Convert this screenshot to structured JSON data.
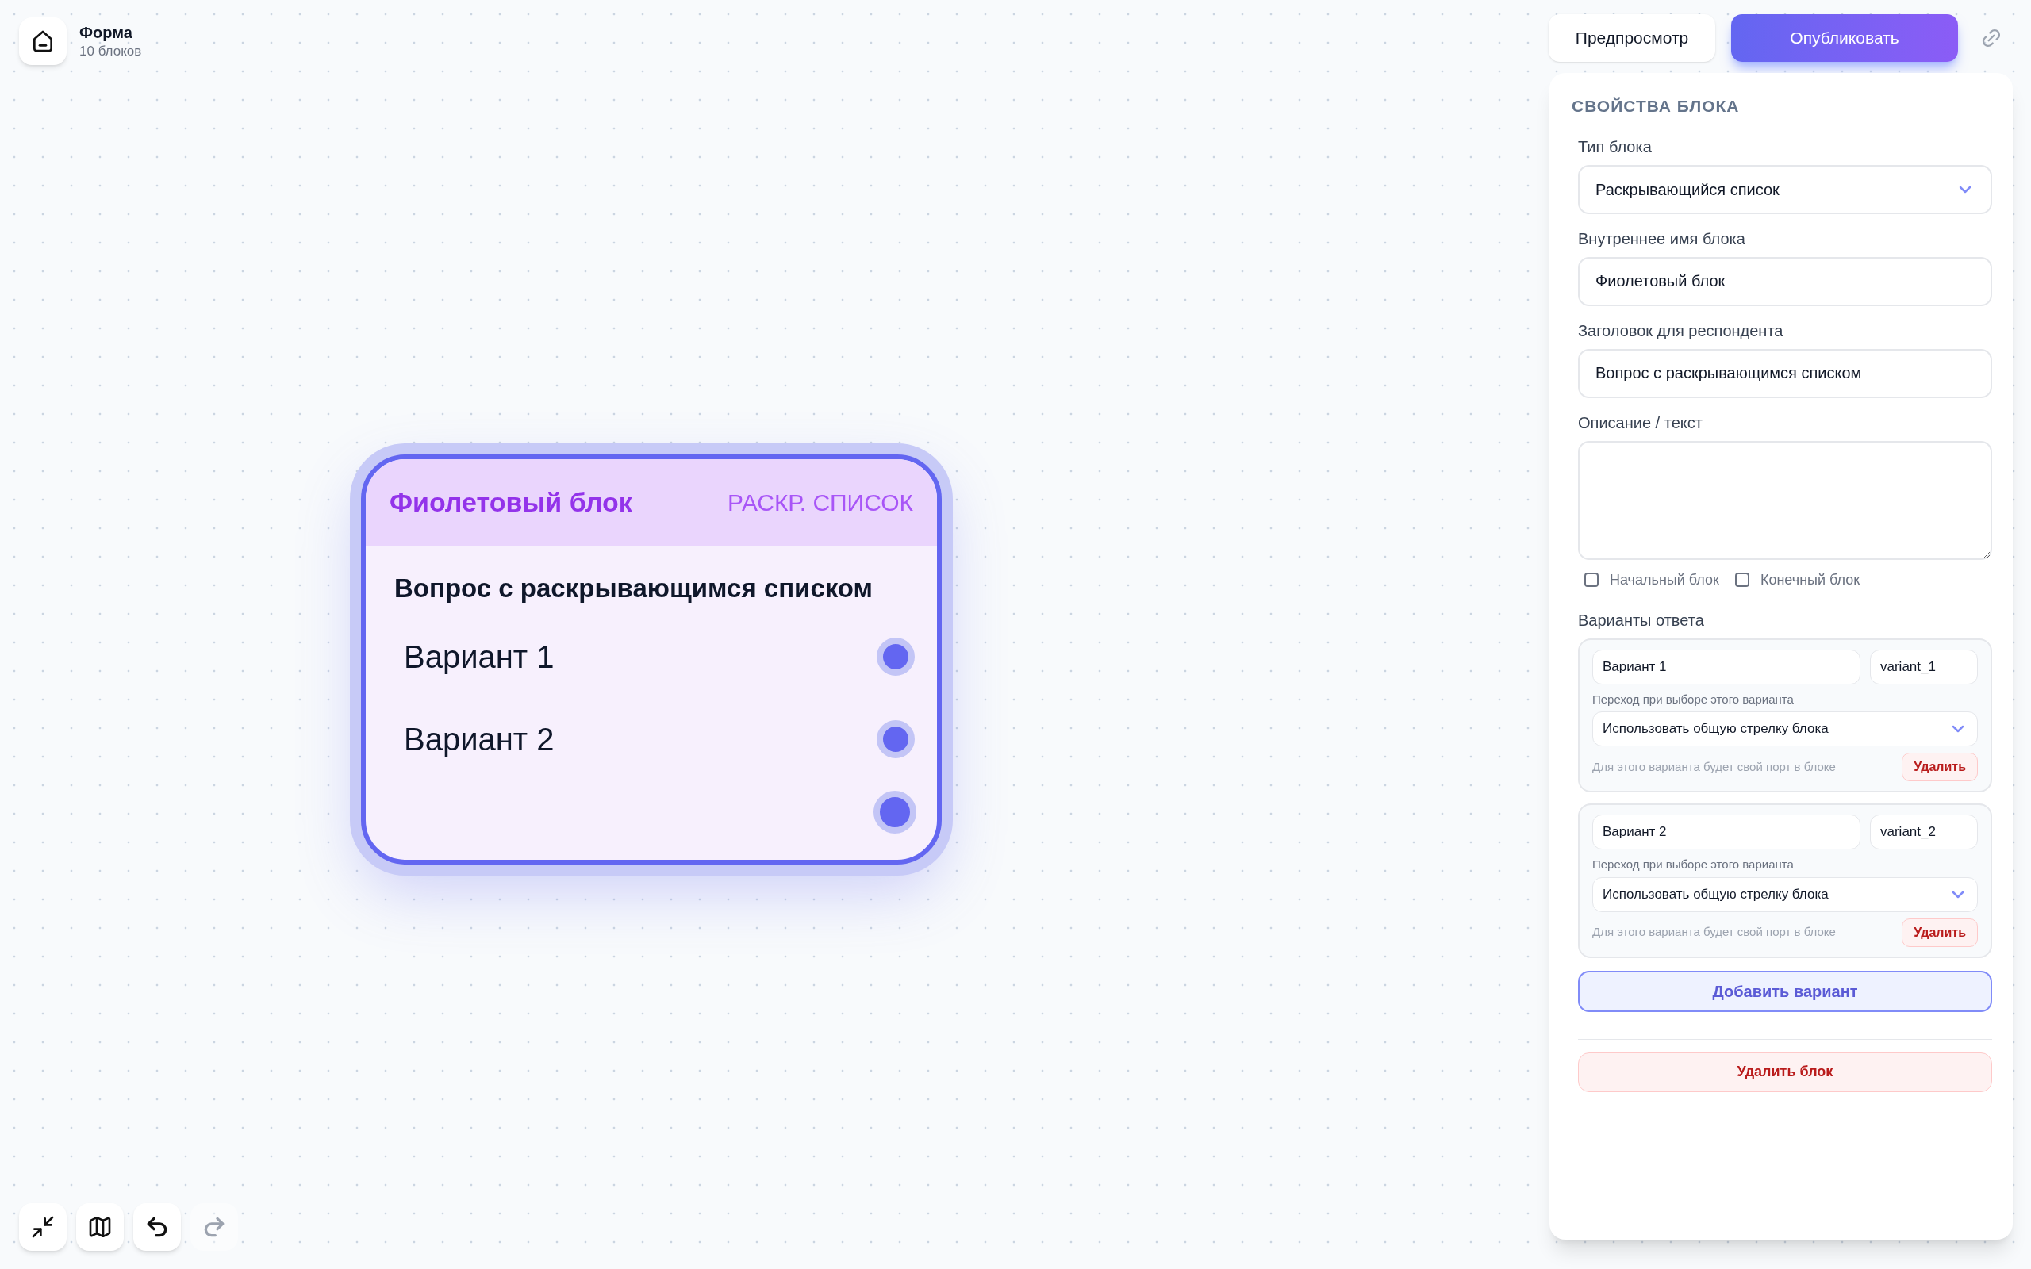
{
  "app": {
    "title": "Форма",
    "subtitle": "10 блоков"
  },
  "actions": {
    "preview": "Предпросмотр",
    "publish": "Опубликовать"
  },
  "node": {
    "title": "Фиолетовый блок",
    "type_label": "РАСКР. СПИСОК",
    "question": "Вопрос с раскрывающимся списком",
    "selected": true,
    "options": [
      {
        "label": "Вариант 1"
      },
      {
        "label": "Вариант 2"
      }
    ]
  },
  "panel": {
    "heading": "СВОЙСТВА БЛОКА",
    "fields": [
      {
        "kind": "select",
        "label": "Тип блока",
        "value": "Раскрывающийся список"
      },
      {
        "kind": "text",
        "label": "Внутреннее имя блока",
        "value": "Фиолетовый блок"
      },
      {
        "kind": "text",
        "label": "Заголовок для респондента",
        "value": "Вопрос с раскрывающимся списком"
      },
      {
        "kind": "textarea",
        "label": "Описание / текст"
      }
    ],
    "checkboxes": [
      {
        "label": "Начальный блок",
        "checked": false
      },
      {
        "label": "Конечный блок",
        "checked": false
      }
    ],
    "answers_label": "Варианты ответа",
    "variants": [
      {
        "label": "Вариант 1",
        "key": "variant_1",
        "transition_label": "Переход при выборе этого варианта",
        "transition_value": "Использовать общую стрелку блока",
        "hint": "Для этого варианта будет свой порт в блоке",
        "delete_label": "Удалить"
      },
      {
        "label": "Вариант 2",
        "key": "variant_2",
        "transition_label": "Переход при выборе этого варианта",
        "transition_value": "Использовать общую стрелку блока",
        "hint": "Для этого варианта будет свой порт в блоке",
        "delete_label": "Удалить"
      }
    ],
    "add_button": "Добавить вариант",
    "delete_block": "Удалить блок"
  },
  "toolbar": [
    {
      "kind": "fit",
      "disabled": false
    },
    {
      "kind": "map",
      "disabled": false
    },
    {
      "kind": "undo",
      "disabled": false
    },
    {
      "kind": "redo",
      "disabled": true
    }
  ]
}
